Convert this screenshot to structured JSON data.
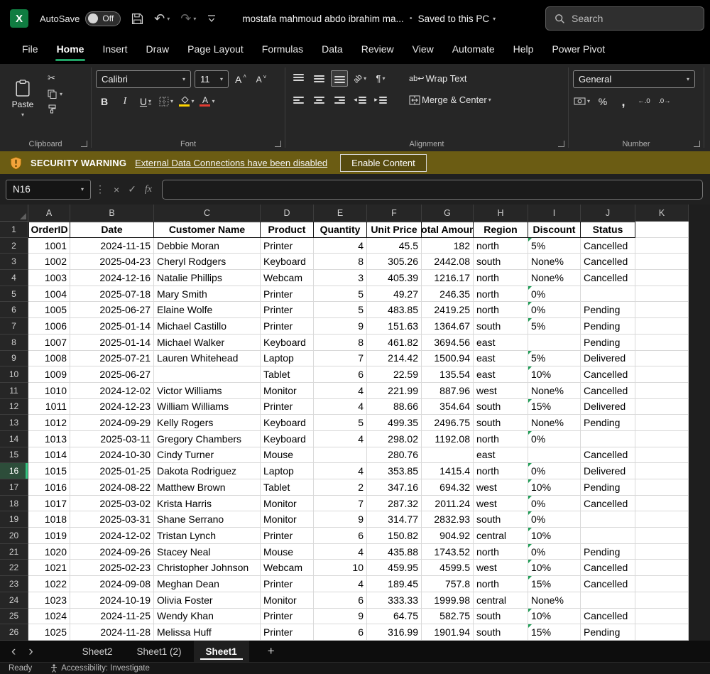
{
  "titlebar": {
    "autosave_label": "AutoSave",
    "autosave_state": "Off",
    "filename": "mostafa mahmoud abdo ibrahim ma...",
    "saved_status": "Saved to this PC",
    "search_placeholder": "Search"
  },
  "menu": {
    "items": [
      "File",
      "Home",
      "Insert",
      "Draw",
      "Page Layout",
      "Formulas",
      "Data",
      "Review",
      "View",
      "Automate",
      "Help",
      "Power Pivot"
    ],
    "active": "Home"
  },
  "ribbon": {
    "paste_label": "Paste",
    "clipboard_group": "Clipboard",
    "font_group": "Font",
    "font_name": "Calibri",
    "font_size": "11",
    "alignment_group": "Alignment",
    "wrap_text_label": "Wrap Text",
    "merge_center_label": "Merge & Center",
    "number_group": "Number",
    "number_format": "General"
  },
  "security_bar": {
    "title": "SECURITY WARNING",
    "message": "External Data Connections have been disabled",
    "button_label": "Enable Content"
  },
  "formula_bar": {
    "name_box": "N16",
    "fx_label": "fx",
    "formula_value": ""
  },
  "sheet": {
    "column_letters": [
      "A",
      "B",
      "C",
      "D",
      "E",
      "F",
      "G",
      "H",
      "I",
      "J",
      "K"
    ],
    "header_row": [
      "OrderID",
      "Date",
      "Customer Name",
      "Product",
      "Quantity",
      "Unit Price",
      "Total Amount",
      "Region",
      "Discount",
      "Status"
    ],
    "selected_row": 16,
    "rows": [
      [
        "1001",
        "2024-11-15",
        "Debbie Moran",
        "Printer",
        "4",
        "45.5",
        "182",
        "north",
        "5%",
        "Cancelled"
      ],
      [
        "1002",
        "2025-04-23",
        "Cheryl Rodgers",
        "Keyboard",
        "8",
        "305.26",
        "2442.08",
        "south",
        "None%",
        "Cancelled"
      ],
      [
        "1003",
        "2024-12-16",
        "Natalie Phillips",
        "Webcam",
        "3",
        "405.39",
        "1216.17",
        "north",
        "None%",
        "Cancelled"
      ],
      [
        "1004",
        "2025-07-18",
        "Mary Smith",
        "Printer",
        "5",
        "49.27",
        "246.35",
        "north",
        "0%",
        ""
      ],
      [
        "1005",
        "2025-06-27",
        "Elaine Wolfe",
        "Printer",
        "5",
        "483.85",
        "2419.25",
        "north",
        "0%",
        "Pending"
      ],
      [
        "1006",
        "2025-01-14",
        "Michael Castillo",
        "Printer",
        "9",
        "151.63",
        "1364.67",
        "south",
        "5%",
        "Pending"
      ],
      [
        "1007",
        "2025-01-14",
        "Michael Walker",
        "Keyboard",
        "8",
        "461.82",
        "3694.56",
        "east",
        "",
        "Pending"
      ],
      [
        "1008",
        "2025-07-21",
        "Lauren Whitehead",
        "Laptop",
        "7",
        "214.42",
        "1500.94",
        "east",
        "5%",
        "Delivered"
      ],
      [
        "1009",
        "2025-06-27",
        "",
        "Tablet",
        "6",
        "22.59",
        "135.54",
        "east",
        "10%",
        "Cancelled"
      ],
      [
        "1010",
        "2024-12-02",
        "Victor Williams",
        "Monitor",
        "4",
        "221.99",
        "887.96",
        "west",
        "None%",
        "Cancelled"
      ],
      [
        "1011",
        "2024-12-23",
        "William Williams",
        "Printer",
        "4",
        "88.66",
        "354.64",
        "south",
        "15%",
        "Delivered"
      ],
      [
        "1012",
        "2024-09-29",
        "Kelly Rogers",
        "Keyboard",
        "5",
        "499.35",
        "2496.75",
        "south",
        "None%",
        "Pending"
      ],
      [
        "1013",
        "2025-03-11",
        "Gregory Chambers",
        "Keyboard",
        "4",
        "298.02",
        "1192.08",
        "north",
        "0%",
        ""
      ],
      [
        "1014",
        "2024-10-30",
        "Cindy Turner",
        "Mouse",
        "",
        "280.76",
        "",
        "east",
        "",
        "Cancelled"
      ],
      [
        "1015",
        "2025-01-25",
        "Dakota Rodriguez",
        "Laptop",
        "4",
        "353.85",
        "1415.4",
        "north",
        "0%",
        "Delivered"
      ],
      [
        "1016",
        "2024-08-22",
        "Matthew Brown",
        "Tablet",
        "2",
        "347.16",
        "694.32",
        "west",
        "10%",
        "Pending"
      ],
      [
        "1017",
        "2025-03-02",
        "Krista Harris",
        "Monitor",
        "7",
        "287.32",
        "2011.24",
        "west",
        "0%",
        "Cancelled"
      ],
      [
        "1018",
        "2025-03-31",
        "Shane Serrano",
        "Monitor",
        "9",
        "314.77",
        "2832.93",
        "south",
        "0%",
        ""
      ],
      [
        "1019",
        "2024-12-02",
        "Tristan Lynch",
        "Printer",
        "6",
        "150.82",
        "904.92",
        "central",
        "10%",
        ""
      ],
      [
        "1020",
        "2024-09-26",
        "Stacey Neal",
        "Mouse",
        "4",
        "435.88",
        "1743.52",
        "north",
        "0%",
        "Pending"
      ],
      [
        "1021",
        "2025-02-23",
        "Christopher Johnson",
        "Webcam",
        "10",
        "459.95",
        "4599.5",
        "west",
        "10%",
        "Cancelled"
      ],
      [
        "1022",
        "2024-09-08",
        "Meghan Dean",
        "Printer",
        "4",
        "189.45",
        "757.8",
        "north",
        "15%",
        "Cancelled"
      ],
      [
        "1023",
        "2024-10-19",
        "Olivia Foster",
        "Monitor",
        "6",
        "333.33",
        "1999.98",
        "central",
        "None%",
        ""
      ],
      [
        "1024",
        "2024-11-25",
        "Wendy Khan",
        "Printer",
        "9",
        "64.75",
        "582.75",
        "south",
        "10%",
        "Cancelled"
      ],
      [
        "1025",
        "2024-11-28",
        "Melissa Huff",
        "Printer",
        "6",
        "316.99",
        "1901.94",
        "south",
        "15%",
        "Pending"
      ]
    ]
  },
  "tabs": {
    "items": [
      "Sheet2",
      "Sheet1 (2)",
      "Sheet1"
    ],
    "active": "Sheet1"
  },
  "status_bar": {
    "ready": "Ready",
    "accessibility": "Accessibility: Investigate"
  }
}
